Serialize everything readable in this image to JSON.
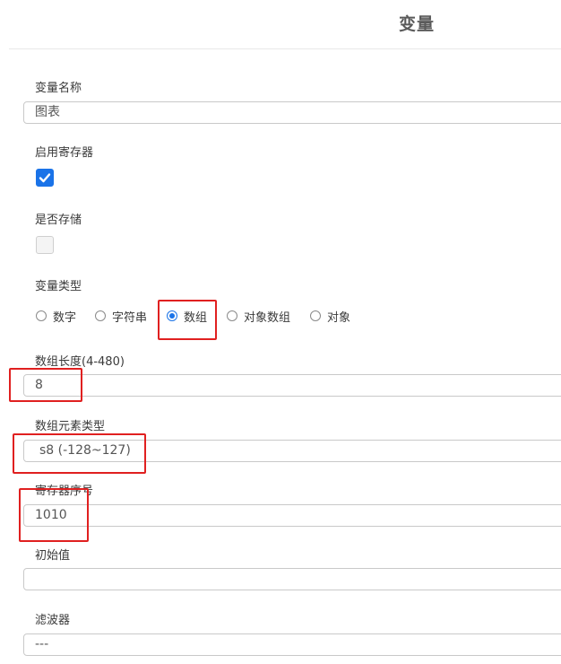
{
  "header": {
    "title": "变量"
  },
  "fields": {
    "variable_name": {
      "label": "变量名称",
      "value": "图表"
    },
    "enable_register": {
      "label": "启用寄存器",
      "checked": true
    },
    "is_stored": {
      "label": "是否存储",
      "checked": false
    },
    "variable_type": {
      "label": "变量类型",
      "options": [
        "数字",
        "字符串",
        "数组",
        "对象数组",
        "对象"
      ],
      "selected": "数组"
    },
    "array_length": {
      "label": "数组长度(4-480)",
      "value": "8"
    },
    "element_type": {
      "label": "数组元素类型",
      "value": "s8 (-128~127)"
    },
    "register_index": {
      "label": "寄存器序号",
      "value": "1010"
    },
    "initial_value": {
      "label": "初始值",
      "value": ""
    },
    "filter": {
      "label": "滤波器",
      "value": "---"
    }
  },
  "colors": {
    "accent": "#1a73e8",
    "highlight": "#e02020",
    "border": "#c9c9c9"
  }
}
